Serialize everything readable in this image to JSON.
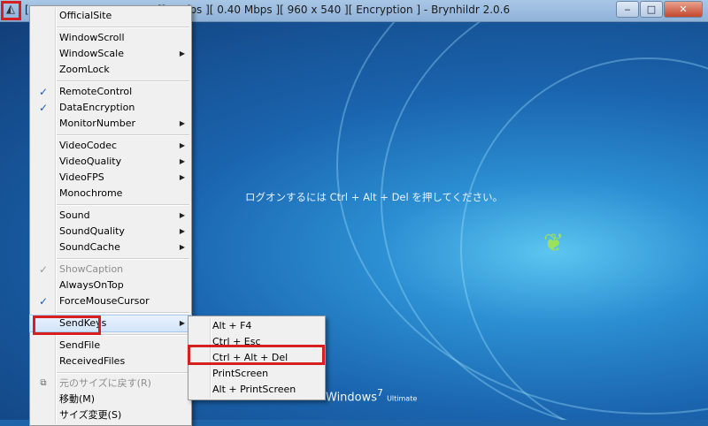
{
  "window": {
    "title": "[ 192.168.10.100:55500 ][ 30 fps ][ 0.40 Mbps ][ 960 x 540 ][ Encryption ] - Brynhildr 2.0.6",
    "minimize_label": "‒",
    "maximize_label": "□",
    "close_label": "✕"
  },
  "desktop": {
    "logon_message": "ログオンするには Ctrl + Alt + Del を押してください。",
    "windows_brand": "Windows",
    "windows_version": "7",
    "windows_edition": "Ultimate"
  },
  "main_menu": {
    "items": [
      {
        "label": "OfficialSite"
      },
      {
        "label": "WindowScroll"
      },
      {
        "label": "WindowScale"
      },
      {
        "label": "ZoomLock"
      },
      {
        "label": "RemoteControl"
      },
      {
        "label": "DataEncryption"
      },
      {
        "label": "MonitorNumber"
      },
      {
        "label": "VideoCodec"
      },
      {
        "label": "VideoQuality"
      },
      {
        "label": "VideoFPS"
      },
      {
        "label": "Monochrome"
      },
      {
        "label": "Sound"
      },
      {
        "label": "SoundQuality"
      },
      {
        "label": "SoundCache"
      },
      {
        "label": "ShowCaption"
      },
      {
        "label": "AlwaysOnTop"
      },
      {
        "label": "ForceMouseCursor"
      },
      {
        "label": "SendKeys"
      },
      {
        "label": "SendFile"
      },
      {
        "label": "ReceivedFiles"
      },
      {
        "label": "元のサイズに戻す(R)"
      },
      {
        "label": "移動(M)"
      },
      {
        "label": "サイズ変更(S)"
      }
    ]
  },
  "sendkeys_menu": {
    "items": [
      {
        "label": "Alt + F4"
      },
      {
        "label": "Ctrl + Esc"
      },
      {
        "label": "Ctrl + Alt + Del"
      },
      {
        "label": "PrintScreen"
      },
      {
        "label": "Alt + PrintScreen"
      }
    ]
  },
  "glyphs": {
    "check": "✓",
    "submenu_arrow": "▶",
    "restore_icon": "⧉"
  }
}
